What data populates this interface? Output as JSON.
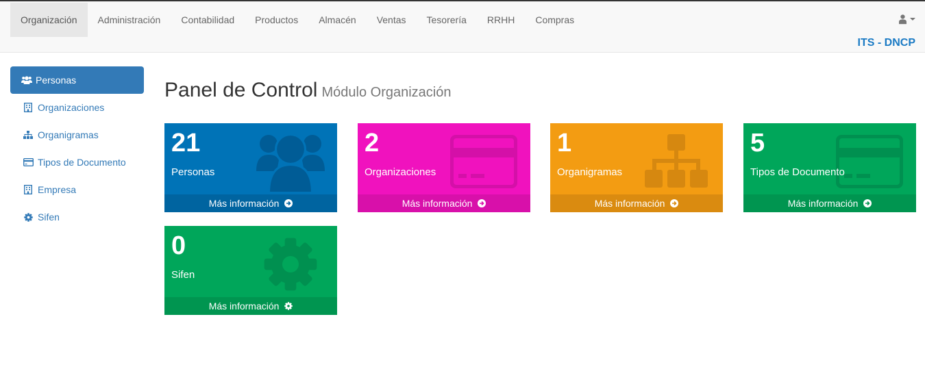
{
  "nav": {
    "items": [
      {
        "label": "Organización",
        "active": true
      },
      {
        "label": "Administración"
      },
      {
        "label": "Contabilidad"
      },
      {
        "label": "Productos"
      },
      {
        "label": "Almacén"
      },
      {
        "label": "Ventas"
      },
      {
        "label": "Tesorería"
      },
      {
        "label": "RRHH"
      },
      {
        "label": "Compras"
      }
    ],
    "user_icon": "user-icon",
    "brand": "ITS - DNCP"
  },
  "sidebar": {
    "items": [
      {
        "label": "Personas",
        "icon": "users-icon",
        "active": true
      },
      {
        "label": "Organizaciones",
        "icon": "building-icon"
      },
      {
        "label": "Organigramas",
        "icon": "sitemap-icon"
      },
      {
        "label": "Tipos de Documento",
        "icon": "credit-card-icon"
      },
      {
        "label": "Empresa",
        "icon": "building-icon"
      },
      {
        "label": "Sifen",
        "icon": "gear-icon"
      }
    ]
  },
  "main": {
    "title": "Panel de Control",
    "subtitle": "Módulo Organización",
    "boxes": [
      {
        "count": "21",
        "label": "Personas",
        "more": "Más información",
        "icon": "users-icon",
        "color": "#0073b7"
      },
      {
        "count": "2",
        "label": "Organizaciones",
        "more": "Más información",
        "icon": "credit-card-icon",
        "color": "#f012be"
      },
      {
        "count": "1",
        "label": "Organigramas",
        "more": "Más información",
        "icon": "sitemap-icon",
        "color": "#f39c12"
      },
      {
        "count": "5",
        "label": "Tipos de Documento",
        "more": "Más información",
        "icon": "credit-card-icon",
        "color": "#00a65a"
      },
      {
        "count": "0",
        "label": "Sifen",
        "more": "Más información",
        "icon": "gear-icon",
        "color": "#00a65a"
      }
    ]
  }
}
